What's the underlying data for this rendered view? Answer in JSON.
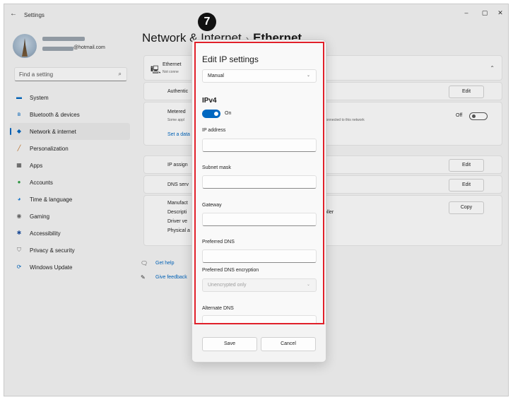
{
  "window": {
    "title": "Settings",
    "controls": {
      "minimize": "–",
      "maximize": "▢",
      "close": "✕"
    }
  },
  "account": {
    "email_suffix": "@hotmail.com"
  },
  "search": {
    "placeholder": "Find a setting"
  },
  "sidebar": {
    "items": [
      {
        "label": "System",
        "icon": "system-icon",
        "color": "#0067c0"
      },
      {
        "label": "Bluetooth & devices",
        "icon": "bluetooth-icon",
        "color": "#0067c0"
      },
      {
        "label": "Network & internet",
        "icon": "network-icon",
        "color": "#0067c0",
        "active": true
      },
      {
        "label": "Personalization",
        "icon": "brush-icon",
        "color": "#c16a1c"
      },
      {
        "label": "Apps",
        "icon": "apps-icon",
        "color": "#444444"
      },
      {
        "label": "Accounts",
        "icon": "accounts-icon",
        "color": "#2f9e44"
      },
      {
        "label": "Time & language",
        "icon": "globe-icon",
        "color": "#1c7ed6"
      },
      {
        "label": "Gaming",
        "icon": "gaming-icon",
        "color": "#666666"
      },
      {
        "label": "Accessibility",
        "icon": "accessibility-icon",
        "color": "#1c4fa0"
      },
      {
        "label": "Privacy & security",
        "icon": "shield-icon",
        "color": "#777777"
      },
      {
        "label": "Windows Update",
        "icon": "update-icon",
        "color": "#0067c0"
      }
    ]
  },
  "header": {
    "part1": "Network & Internet",
    "separator": "›",
    "part2": "Ethernet"
  },
  "ethernet": {
    "title": "Ethernet",
    "subtitle": "Not conne",
    "authentication": "Authentic",
    "edit_label": "Edit",
    "metered_title": "Metered",
    "metered_sub": "Some appl",
    "metered_note": "connected to this network",
    "metered_toggle": "Off",
    "set_data_link": "Set a data",
    "ip_assign": "IP assign",
    "dns_server": "DNS serv",
    "manufacturer": "Manufact",
    "description": "Descripti",
    "description_tail": "oller",
    "driver": "Driver ve",
    "physical": "Physical a",
    "copy_label": "Copy"
  },
  "help": {
    "get_help": "Get help",
    "feedback": "Give feedback"
  },
  "dialog": {
    "title": "Edit IP settings",
    "mode": "Manual",
    "section": "IPv4",
    "ipv4_toggle": "On",
    "fields": {
      "ip_address": "IP address",
      "subnet_mask": "Subnet mask",
      "gateway": "Gateway",
      "preferred_dns": "Preferred DNS",
      "preferred_dns_encryption": "Preferred DNS encryption",
      "encryption_value": "Unencrypted only",
      "alternate_dns": "Alternate DNS"
    },
    "save": "Save",
    "cancel": "Cancel"
  },
  "annotation": {
    "step": "7",
    "highlight_color": "#e0202a"
  }
}
